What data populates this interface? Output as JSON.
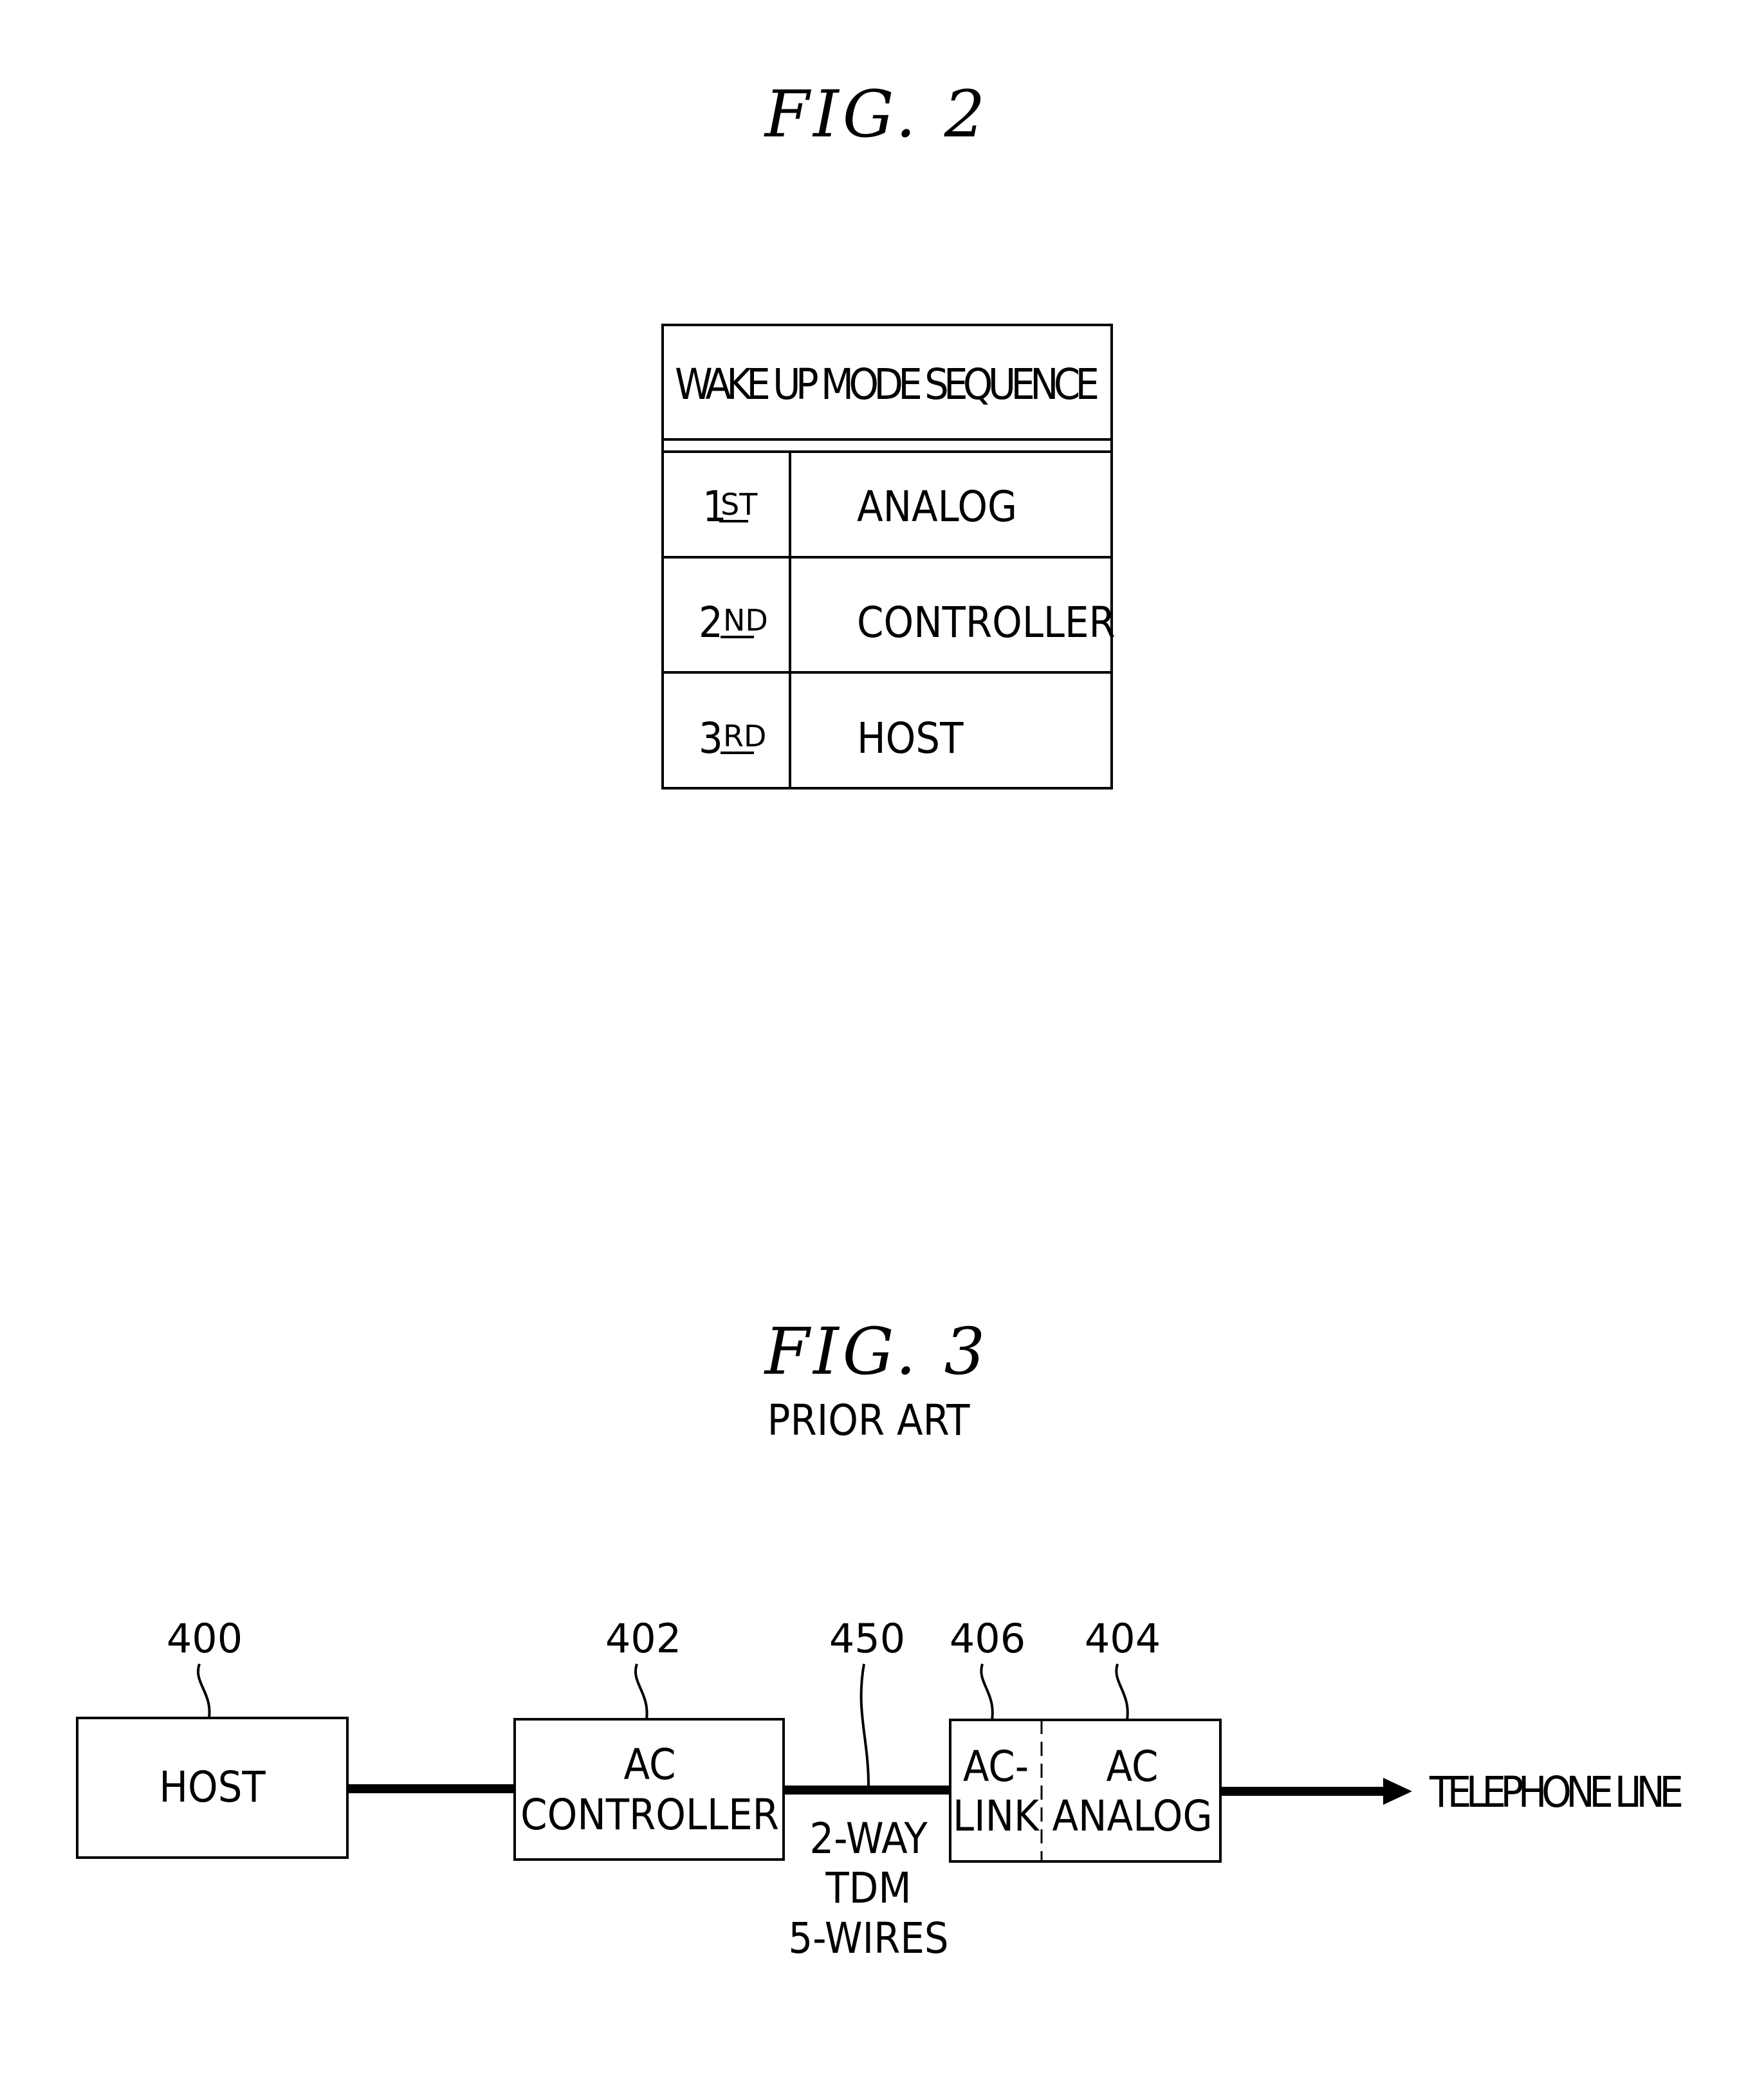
{
  "fig2": {
    "title": "FIG.  2",
    "table": {
      "header": "WAKE UP MODE SEQUENCE",
      "rows": [
        {
          "ordinal_num": "1",
          "ordinal_suffix": "ST",
          "value": "ANALOG"
        },
        {
          "ordinal_num": "2",
          "ordinal_suffix": "ND",
          "value": "CONTROLLER"
        },
        {
          "ordinal_num": "3",
          "ordinal_suffix": "RD",
          "value": "HOST"
        }
      ]
    }
  },
  "fig3": {
    "title": "FIG.  3",
    "subtitle": "PRIOR ART",
    "blocks": {
      "host": {
        "ref": "400",
        "label": "HOST"
      },
      "controller": {
        "ref": "402",
        "line1": "AC",
        "line2": "CONTROLLER"
      },
      "aclink": {
        "ref": "406",
        "line1": "AC-",
        "line2": "LINK"
      },
      "analog": {
        "ref": "404",
        "line1": "AC",
        "line2": "ANALOG"
      }
    },
    "bus": {
      "ref": "450",
      "line1": "2-WAY",
      "line2": "TDM",
      "line3": "5-WIRES"
    },
    "output_label": "TELEPHONE LINE"
  }
}
